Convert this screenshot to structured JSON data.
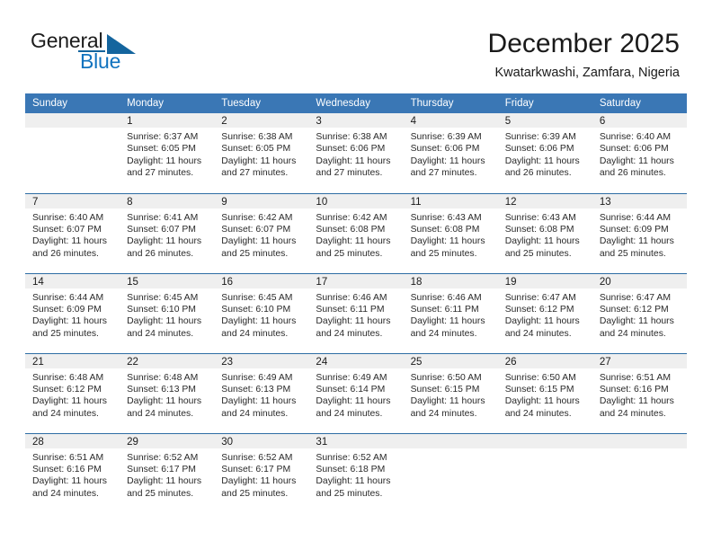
{
  "brand": {
    "word_one": "General",
    "word_two": "Blue",
    "icon": "triangle-logo"
  },
  "header": {
    "month_title": "December 2025",
    "location": "Kwatarkwashi, Zamfara, Nigeria"
  },
  "calendar": {
    "weekday_headers": [
      "Sunday",
      "Monday",
      "Tuesday",
      "Wednesday",
      "Thursday",
      "Friday",
      "Saturday"
    ],
    "labels": {
      "sunrise_prefix": "Sunrise:",
      "sunset_prefix": "Sunset:",
      "daylight_prefix": "Daylight:"
    },
    "colors": {
      "header_bg": "#3a77b5",
      "header_text": "#ffffff",
      "daynum_bg": "#efefef",
      "row_rule": "#2e6da4",
      "brand_blue": "#1173bf",
      "page_bg": "#ffffff"
    },
    "weeks": [
      [
        {
          "day": "",
          "sunrise": "",
          "sunset": "",
          "daylight": "",
          "empty": true
        },
        {
          "day": "1",
          "sunrise": "Sunrise: 6:37 AM",
          "sunset": "Sunset: 6:05 PM",
          "daylight": "Daylight: 11 hours and 27 minutes."
        },
        {
          "day": "2",
          "sunrise": "Sunrise: 6:38 AM",
          "sunset": "Sunset: 6:05 PM",
          "daylight": "Daylight: 11 hours and 27 minutes."
        },
        {
          "day": "3",
          "sunrise": "Sunrise: 6:38 AM",
          "sunset": "Sunset: 6:06 PM",
          "daylight": "Daylight: 11 hours and 27 minutes."
        },
        {
          "day": "4",
          "sunrise": "Sunrise: 6:39 AM",
          "sunset": "Sunset: 6:06 PM",
          "daylight": "Daylight: 11 hours and 27 minutes."
        },
        {
          "day": "5",
          "sunrise": "Sunrise: 6:39 AM",
          "sunset": "Sunset: 6:06 PM",
          "daylight": "Daylight: 11 hours and 26 minutes."
        },
        {
          "day": "6",
          "sunrise": "Sunrise: 6:40 AM",
          "sunset": "Sunset: 6:06 PM",
          "daylight": "Daylight: 11 hours and 26 minutes."
        }
      ],
      [
        {
          "day": "7",
          "sunrise": "Sunrise: 6:40 AM",
          "sunset": "Sunset: 6:07 PM",
          "daylight": "Daylight: 11 hours and 26 minutes."
        },
        {
          "day": "8",
          "sunrise": "Sunrise: 6:41 AM",
          "sunset": "Sunset: 6:07 PM",
          "daylight": "Daylight: 11 hours and 26 minutes."
        },
        {
          "day": "9",
          "sunrise": "Sunrise: 6:42 AM",
          "sunset": "Sunset: 6:07 PM",
          "daylight": "Daylight: 11 hours and 25 minutes."
        },
        {
          "day": "10",
          "sunrise": "Sunrise: 6:42 AM",
          "sunset": "Sunset: 6:08 PM",
          "daylight": "Daylight: 11 hours and 25 minutes."
        },
        {
          "day": "11",
          "sunrise": "Sunrise: 6:43 AM",
          "sunset": "Sunset: 6:08 PM",
          "daylight": "Daylight: 11 hours and 25 minutes."
        },
        {
          "day": "12",
          "sunrise": "Sunrise: 6:43 AM",
          "sunset": "Sunset: 6:08 PM",
          "daylight": "Daylight: 11 hours and 25 minutes."
        },
        {
          "day": "13",
          "sunrise": "Sunrise: 6:44 AM",
          "sunset": "Sunset: 6:09 PM",
          "daylight": "Daylight: 11 hours and 25 minutes."
        }
      ],
      [
        {
          "day": "14",
          "sunrise": "Sunrise: 6:44 AM",
          "sunset": "Sunset: 6:09 PM",
          "daylight": "Daylight: 11 hours and 25 minutes."
        },
        {
          "day": "15",
          "sunrise": "Sunrise: 6:45 AM",
          "sunset": "Sunset: 6:10 PM",
          "daylight": "Daylight: 11 hours and 24 minutes."
        },
        {
          "day": "16",
          "sunrise": "Sunrise: 6:45 AM",
          "sunset": "Sunset: 6:10 PM",
          "daylight": "Daylight: 11 hours and 24 minutes."
        },
        {
          "day": "17",
          "sunrise": "Sunrise: 6:46 AM",
          "sunset": "Sunset: 6:11 PM",
          "daylight": "Daylight: 11 hours and 24 minutes."
        },
        {
          "day": "18",
          "sunrise": "Sunrise: 6:46 AM",
          "sunset": "Sunset: 6:11 PM",
          "daylight": "Daylight: 11 hours and 24 minutes."
        },
        {
          "day": "19",
          "sunrise": "Sunrise: 6:47 AM",
          "sunset": "Sunset: 6:12 PM",
          "daylight": "Daylight: 11 hours and 24 minutes."
        },
        {
          "day": "20",
          "sunrise": "Sunrise: 6:47 AM",
          "sunset": "Sunset: 6:12 PM",
          "daylight": "Daylight: 11 hours and 24 minutes."
        }
      ],
      [
        {
          "day": "21",
          "sunrise": "Sunrise: 6:48 AM",
          "sunset": "Sunset: 6:12 PM",
          "daylight": "Daylight: 11 hours and 24 minutes."
        },
        {
          "day": "22",
          "sunrise": "Sunrise: 6:48 AM",
          "sunset": "Sunset: 6:13 PM",
          "daylight": "Daylight: 11 hours and 24 minutes."
        },
        {
          "day": "23",
          "sunrise": "Sunrise: 6:49 AM",
          "sunset": "Sunset: 6:13 PM",
          "daylight": "Daylight: 11 hours and 24 minutes."
        },
        {
          "day": "24",
          "sunrise": "Sunrise: 6:49 AM",
          "sunset": "Sunset: 6:14 PM",
          "daylight": "Daylight: 11 hours and 24 minutes."
        },
        {
          "day": "25",
          "sunrise": "Sunrise: 6:50 AM",
          "sunset": "Sunset: 6:15 PM",
          "daylight": "Daylight: 11 hours and 24 minutes."
        },
        {
          "day": "26",
          "sunrise": "Sunrise: 6:50 AM",
          "sunset": "Sunset: 6:15 PM",
          "daylight": "Daylight: 11 hours and 24 minutes."
        },
        {
          "day": "27",
          "sunrise": "Sunrise: 6:51 AM",
          "sunset": "Sunset: 6:16 PM",
          "daylight": "Daylight: 11 hours and 24 minutes."
        }
      ],
      [
        {
          "day": "28",
          "sunrise": "Sunrise: 6:51 AM",
          "sunset": "Sunset: 6:16 PM",
          "daylight": "Daylight: 11 hours and 24 minutes."
        },
        {
          "day": "29",
          "sunrise": "Sunrise: 6:52 AM",
          "sunset": "Sunset: 6:17 PM",
          "daylight": "Daylight: 11 hours and 25 minutes."
        },
        {
          "day": "30",
          "sunrise": "Sunrise: 6:52 AM",
          "sunset": "Sunset: 6:17 PM",
          "daylight": "Daylight: 11 hours and 25 minutes."
        },
        {
          "day": "31",
          "sunrise": "Sunrise: 6:52 AM",
          "sunset": "Sunset: 6:18 PM",
          "daylight": "Daylight: 11 hours and 25 minutes."
        },
        {
          "day": "",
          "sunrise": "",
          "sunset": "",
          "daylight": "",
          "empty": true
        },
        {
          "day": "",
          "sunrise": "",
          "sunset": "",
          "daylight": "",
          "empty": true
        },
        {
          "day": "",
          "sunrise": "",
          "sunset": "",
          "daylight": "",
          "empty": true
        }
      ]
    ]
  }
}
